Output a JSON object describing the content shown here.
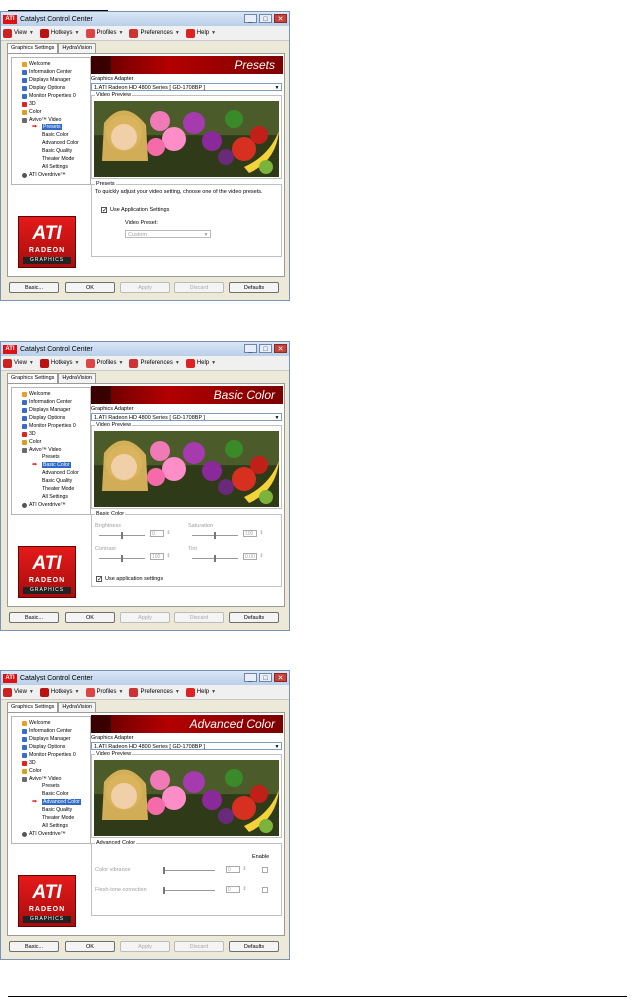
{
  "app": {
    "title": "Catalyst Control Center",
    "window_buttons": [
      "_",
      "□",
      "✕"
    ],
    "toolbar": [
      "View",
      "Hotkeys",
      "Profiles",
      "Preferences",
      "Help"
    ],
    "tabs": [
      "Graphics Settings",
      "HydraVision"
    ],
    "tree": [
      "Welcome",
      "Information Center",
      "Displays Manager",
      "Display Options",
      "Monitor Properties 0",
      "3D",
      "Color",
      "Avivo™ Video",
      "Presets",
      "Basic Color",
      "Advanced Color",
      "Basic Quality",
      "Theater Mode",
      "All Settings",
      "ATI Overdrive™"
    ],
    "logo": {
      "brand": "ATI",
      "line2": "RADEON",
      "line3": "GRAPHICS"
    },
    "buttons": [
      "Basic...",
      "OK",
      "Apply",
      "Discard",
      "Defaults"
    ],
    "adapter_label": "Graphics Adapter",
    "adapter_value": "1.ATI Radeon HD 4800 Series [ GD-1708BP ]",
    "video_preview_label": "Video Preview"
  },
  "windows": [
    {
      "banner": "Presets",
      "selected": "Presets",
      "group_title": "Presets",
      "desc": "To quickly adjust your video setting, choose one of the video presets.",
      "checkbox": "Use Application Settings",
      "preset_label": "Video Preset:",
      "preset_value": "Custom"
    },
    {
      "banner": "Basic Color",
      "selected": "Basic Color",
      "group_title": "Basic Color",
      "brightness": "Brightness",
      "brightness_val": "0",
      "saturation": "Saturation",
      "saturation_val": "100",
      "contrast": "Contrast",
      "contrast_val": "100",
      "tint": "Tint",
      "tint_val": "0.00",
      "checkbox": "Use application settings"
    },
    {
      "banner": "Advanced Color",
      "selected": "Advanced Color",
      "group_title": "Advanced Color",
      "enable": "Enable",
      "vibrance": "Color vibrance",
      "vibrance_val": "0",
      "flesh": "Flesh-tone correction",
      "flesh_val": "0"
    }
  ],
  "colors": {
    "ati_red": "#d11a1a",
    "selection_blue": "#316ac5"
  }
}
